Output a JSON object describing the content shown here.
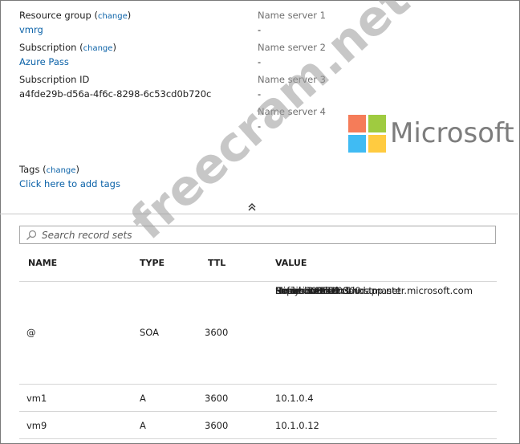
{
  "essentials": {
    "resource_group": {
      "label": "Resource group",
      "change": "change",
      "value": "vmrg"
    },
    "subscription": {
      "label": "Subscription",
      "change": "change",
      "value": "Azure Pass"
    },
    "subscription_id": {
      "label": "Subscription ID",
      "value": "a4fde29b-d56a-4f6c-8298-6c53cd0b720c"
    },
    "tags": {
      "label": "Tags",
      "change": "change",
      "value": "Click here to add tags"
    },
    "name_servers": [
      {
        "label": "Name server 1",
        "value": "-"
      },
      {
        "label": "Name server 2",
        "value": "-"
      },
      {
        "label": "Name server 3",
        "value": "-"
      },
      {
        "label": "Name server 4",
        "value": "-"
      }
    ]
  },
  "collapse_icon": "chevron-double-up-icon",
  "search": {
    "placeholder": "Search record sets",
    "icon": "search-icon"
  },
  "table": {
    "headers": {
      "name": "NAME",
      "type": "TYPE",
      "ttl": "TTL",
      "value": "VALUE"
    },
    "rows": [
      {
        "name": "@",
        "type": "SOA",
        "ttl": "3600",
        "values": [
          "Email: azuredns-hostmaster.microsoft.com",
          "Host: internal.cloudapp.net",
          "Refresh: 3600",
          "Retry: 300",
          "Expire:2419200",
          "Minimum TTL: 300",
          "Serial number: 1"
        ]
      },
      {
        "name": "vm1",
        "type": "A",
        "ttl": "3600",
        "values": [
          "10.1.0.4"
        ]
      },
      {
        "name": "vm9",
        "type": "A",
        "ttl": "3600",
        "values": [
          "10.1.0.12"
        ]
      }
    ]
  },
  "watermark": {
    "brand": "Microsoft",
    "site": "freecram.net"
  },
  "colors": {
    "link": "#0b62a8",
    "ms_red": "#f25022",
    "ms_green": "#7fba00",
    "ms_blue": "#00a4ef",
    "ms_yellow": "#ffb900"
  }
}
